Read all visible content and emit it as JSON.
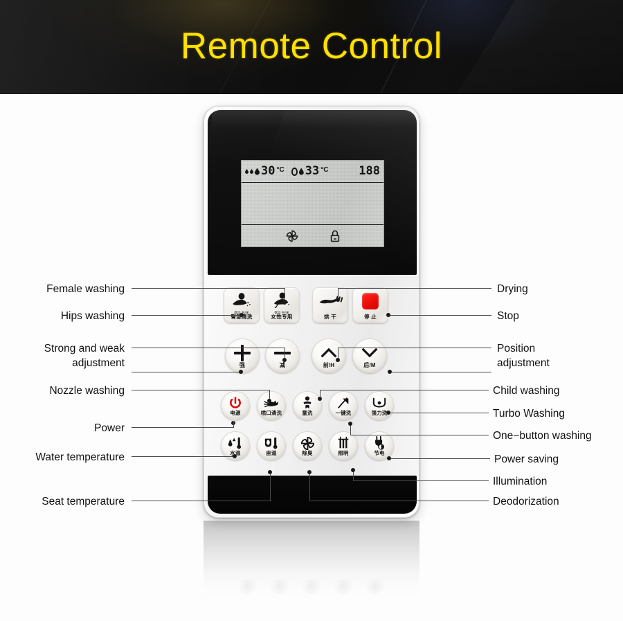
{
  "header": {
    "title": "Remote Control",
    "title_color": "#FFE000",
    "background_color": "#111111"
  },
  "device": {
    "name": "bidet-toilet-seat-remote",
    "body_color": "#f2f2f2",
    "panel_color": "#0d0d0d"
  },
  "lcd": {
    "water_temp_value": "30",
    "water_temp_unit": "°C",
    "seat_temp_value": "33",
    "seat_temp_unit": "°C",
    "right_segment": "188",
    "icons": {
      "water_drop": "water-drop-icon",
      "seat": "seat-icon",
      "fan": "fan-icon",
      "lock": "lock-icon"
    }
  },
  "buttons": {
    "row1": [
      {
        "key": "hips-washing",
        "cn": "臀部清洗",
        "sub": "摆动 开/关",
        "icon": "rear-wash-icon"
      },
      {
        "key": "female-washing",
        "cn": "女性专用",
        "sub": "摆动 开/关",
        "icon": "female-wash-icon"
      },
      {
        "key": "drying",
        "cn": "烘 干",
        "sub": "",
        "icon": "dryer-hand-icon"
      },
      {
        "key": "stop",
        "cn": "停 止",
        "sub": "",
        "icon": "stop-square-icon"
      }
    ],
    "row2": [
      {
        "key": "strong",
        "cn": "强",
        "icon": "plus-icon"
      },
      {
        "key": "weak",
        "cn": "减",
        "icon": "minus-icon"
      },
      {
        "key": "forward",
        "cn": "前/H",
        "icon": "chevron-up-icon"
      },
      {
        "key": "backward",
        "cn": "后/M",
        "icon": "chevron-down-icon"
      }
    ],
    "row3": [
      {
        "key": "power",
        "cn": "电源",
        "icon": "power-icon"
      },
      {
        "key": "nozzle-washing",
        "cn": "喷口清洗",
        "icon": "nozzle-clean-icon"
      },
      {
        "key": "child-washing",
        "cn": "童洗",
        "icon": "child-icon"
      },
      {
        "key": "one-button-washing",
        "cn": "一键洗",
        "icon": "one-key-wash-icon"
      },
      {
        "key": "turbo-washing",
        "cn": "强力洗",
        "icon": "turbo-wash-icon"
      }
    ],
    "row4": [
      {
        "key": "water-temperature",
        "cn": "水温",
        "icon": "water-thermometer-icon"
      },
      {
        "key": "seat-temperature",
        "cn": "座温",
        "icon": "seat-thermometer-icon"
      },
      {
        "key": "deodorization",
        "cn": "除臭",
        "icon": "fan-icon"
      },
      {
        "key": "illumination",
        "cn": "照明",
        "icon": "lamp-icon"
      },
      {
        "key": "power-saving",
        "cn": "节电",
        "icon": "plug-saving-icon"
      }
    ]
  },
  "callouts": {
    "left": [
      {
        "key": "female-washing",
        "text": "Female washing"
      },
      {
        "key": "hips-washing",
        "text": "Hips washing"
      },
      {
        "key": "strong-weak-adjustment",
        "line1": "Strong and weak",
        "line2": "adjustment"
      },
      {
        "key": "nozzle-washing",
        "text": "Nozzle washing"
      },
      {
        "key": "power",
        "text": "Power"
      },
      {
        "key": "water-temperature",
        "text": "Water temperature"
      },
      {
        "key": "seat-temperature",
        "text": "Seat temperature"
      }
    ],
    "right": [
      {
        "key": "drying",
        "text": "Drying"
      },
      {
        "key": "stop",
        "text": "Stop"
      },
      {
        "key": "position-adjustment",
        "line1": "Position",
        "line2": "adjustment"
      },
      {
        "key": "child-washing",
        "text": "Child washing"
      },
      {
        "key": "turbo-washing",
        "text": "Turbo Washing"
      },
      {
        "key": "one-button-washing",
        "text": "One−button washing"
      },
      {
        "key": "power-saving",
        "text": "Power saving"
      },
      {
        "key": "illumination",
        "text": "Illumination"
      },
      {
        "key": "deodorization",
        "text": "Deodorization"
      }
    ]
  }
}
